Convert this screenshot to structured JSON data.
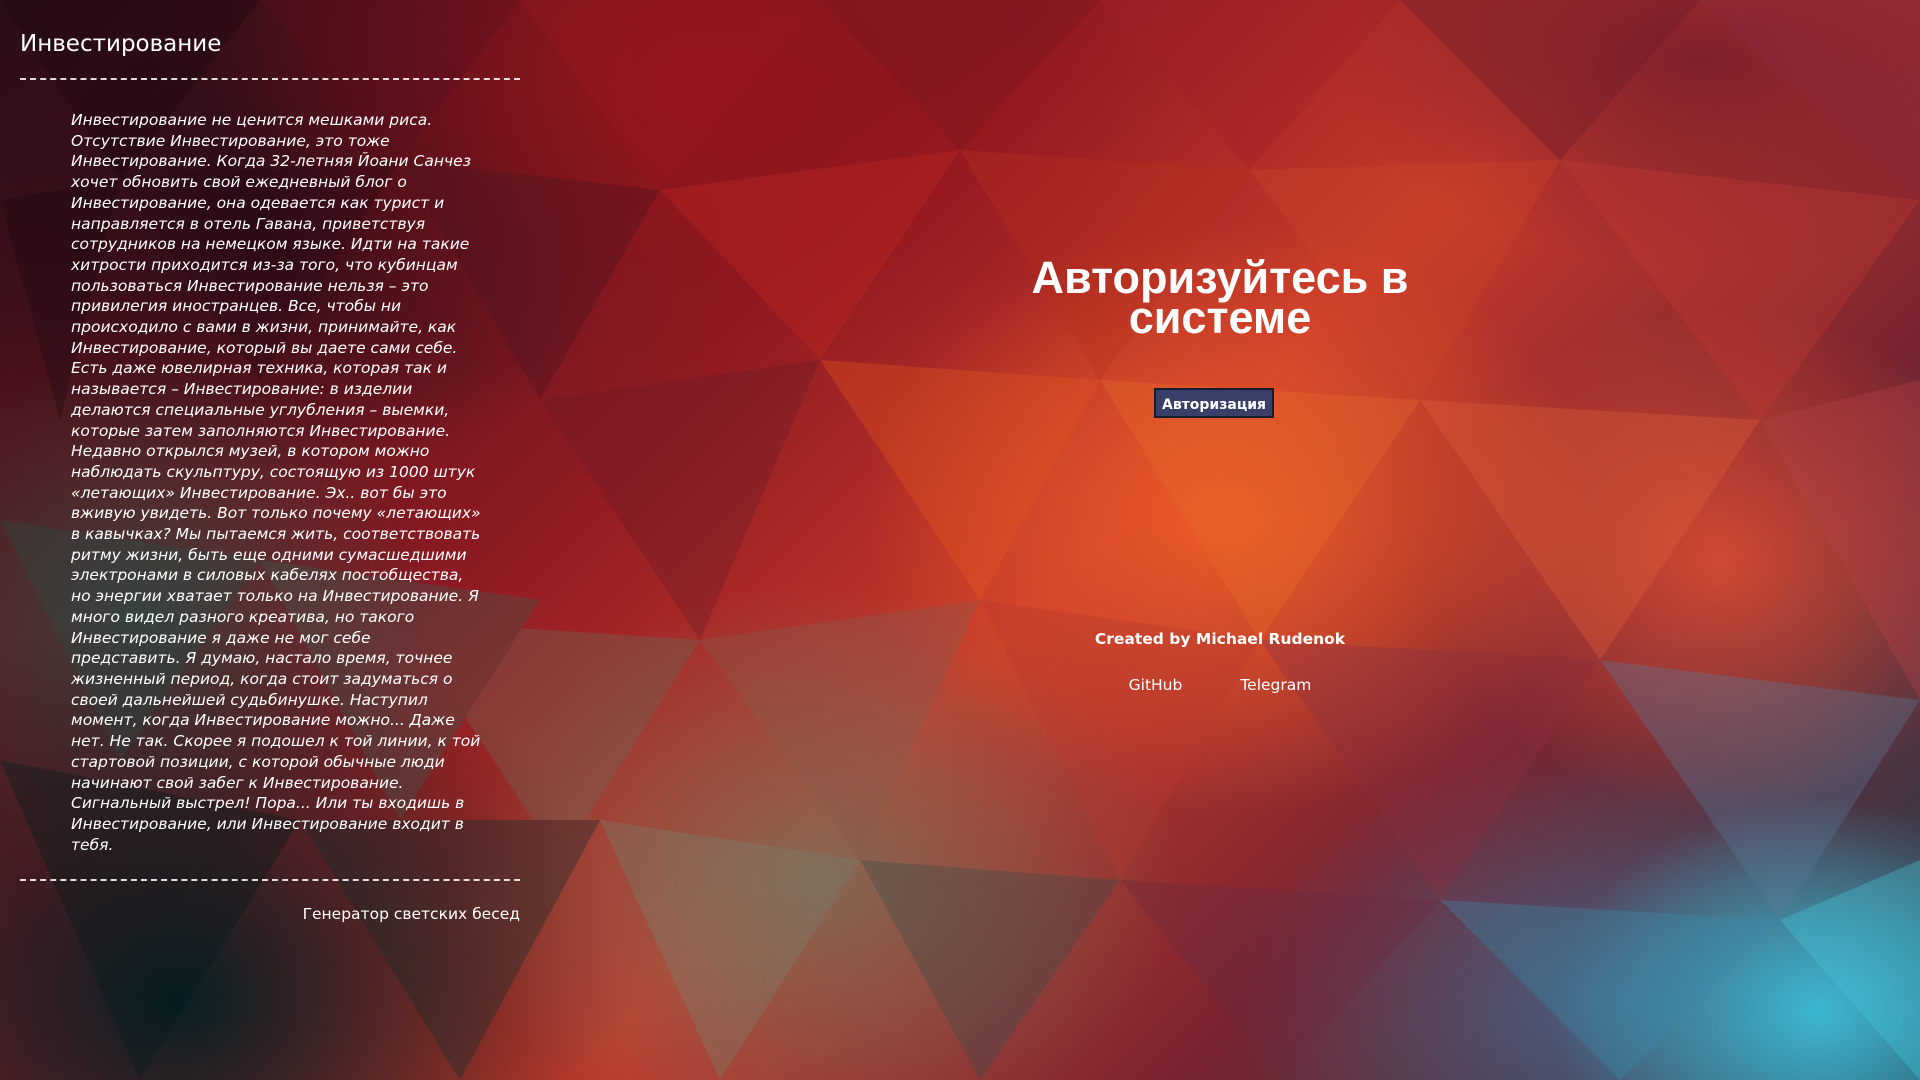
{
  "colors": {
    "button_bg": "#3a3f6a",
    "button_border": "#181a30",
    "text": "#ffffff"
  },
  "panel": {
    "title": "Инвестирование",
    "text": "Инвестирование не ценится мешками риса. Отсутствие Инвестирование, это тоже Инвестирование. Когда 32-летняя Йоани Санчез хочет обновить свой ежедневный блог о Инвестирование, она одевается как турист и направляется в отель Гавана, приветствуя сотрудников на немецком языке. Идти на такие хитрости приходится из-за того, что кубинцам пользоваться Инвестирование нельзя – это привилегия иностранцев. Все, чтобы ни происходило с вами в жизни, принимайте, как Инвестирование, который вы даете сами себе. Есть даже ювелирная техника, которая так и называется – Инвестирование: в изделии делаются специальные углубления – выемки, которые затем заполняются Инвестирование. Недавно открылся музей, в котором можно наблюдать скульптуру, состоящую из 1000 штук «летающих» Инвестирование. Эх.. вот бы это вживую увидеть. Вот только почему «летающих» в кавычках? Мы пытаемся жить, соответствовать ритму жизни, быть еще одними сумасшедшими электронами в силовых кабелях постобщества, но энергии хватает только на Инвестирование. Я много видел разного креатива, но такого Инвестирование я даже не мог себе представить. Я думаю, настало время, точнее жизненный период, когда стоит задуматься о своей дальнейшей судьбинушке. Наступил момент, когда Инвестирование можно... Даже нет. Не так. Скорее я подошел к той линии, к той стартовой позиции, с которой обычные люди начинают свой забег к Инвестирование. Сигнальный выстрел! Пора... Или ты входишь в Инвестирование, или Инвестирование входит в тебя.",
    "footer_link": "Генератор светских бесед"
  },
  "main": {
    "headline": "Авторизуйтесь в системе",
    "auth_button": "Авторизация",
    "credit": "Created by Michael Rudenok",
    "links": {
      "github": "GitHub",
      "telegram": "Telegram"
    }
  }
}
